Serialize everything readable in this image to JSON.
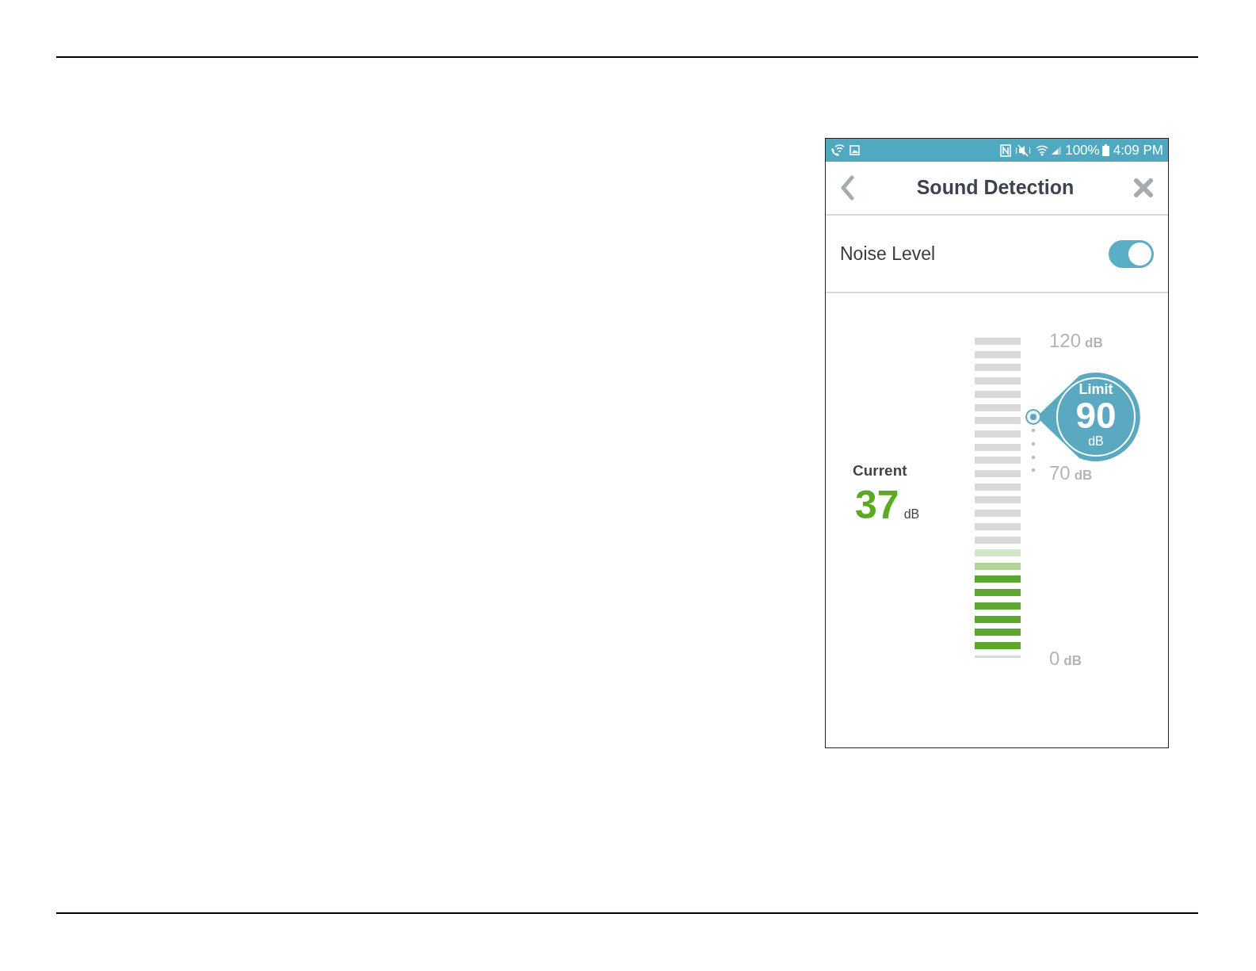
{
  "status_bar": {
    "battery": "100%",
    "time": "4:09 PM"
  },
  "header": {
    "title": "Sound Detection"
  },
  "noise_level": {
    "label": "Noise Level",
    "on": true
  },
  "meter": {
    "current_label": "Current",
    "current_value": "37",
    "current_unit": "dB",
    "level": 0.33,
    "limit": {
      "label": "Limit",
      "value": "90",
      "unit": "dB",
      "level": 0.75
    },
    "scale": [
      {
        "value": "120",
        "unit": "dB"
      },
      {
        "value": "70",
        "unit": "dB"
      },
      {
        "value": "0",
        "unit": "dB"
      }
    ]
  }
}
